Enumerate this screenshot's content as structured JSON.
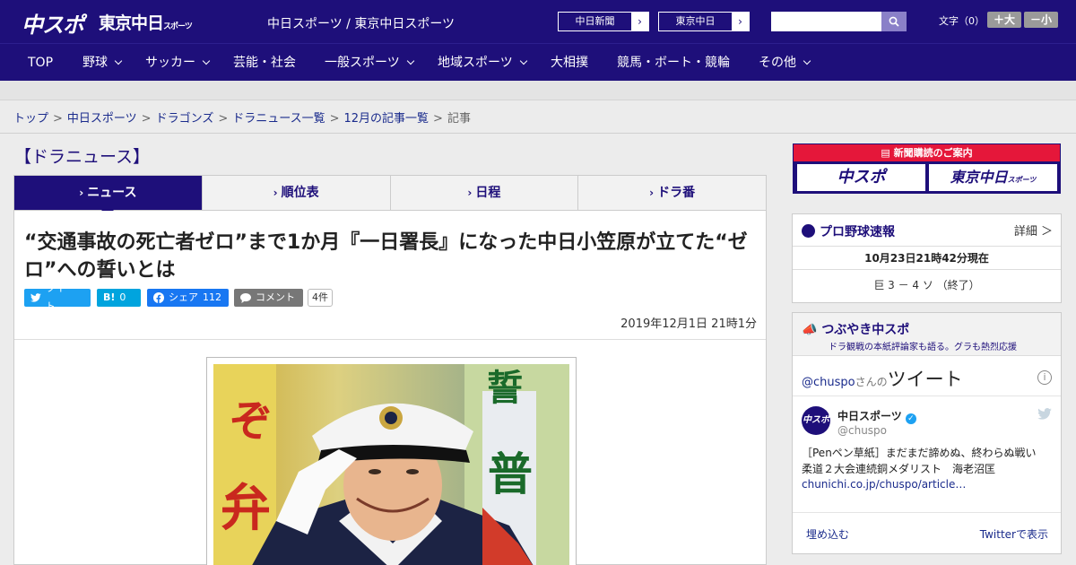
{
  "header": {
    "logo_main": "中スポ",
    "logo_tokyo": "東京中日",
    "logo_tokyo_sub": "スポーツ",
    "site_title": "中日スポーツ / 東京中日スポーツ",
    "paper_links": [
      "中日新聞",
      "東京中日"
    ],
    "search_placeholder": "",
    "font_size_label": "文字（0）",
    "font_larger": "＋大",
    "font_smaller": "－小"
  },
  "nav": {
    "items": [
      {
        "label": "TOP",
        "dropdown": false
      },
      {
        "label": "野球",
        "dropdown": true
      },
      {
        "label": "サッカー",
        "dropdown": true
      },
      {
        "label": "芸能・社会",
        "dropdown": false
      },
      {
        "label": "一般スポーツ",
        "dropdown": true
      },
      {
        "label": "地域スポーツ",
        "dropdown": true
      },
      {
        "label": "大相撲",
        "dropdown": false
      },
      {
        "label": "競馬・ボート・競輪",
        "dropdown": false
      },
      {
        "label": "その他",
        "dropdown": true
      }
    ]
  },
  "breadcrumb": [
    "トップ",
    "中日スポーツ",
    "ドラゴンズ",
    "ドラニュース一覧",
    "12月の記事一覧",
    "記事"
  ],
  "section_title": "【ドラニュース】",
  "tabs": [
    {
      "label": "ニュース",
      "active": true
    },
    {
      "label": "順位表",
      "active": false
    },
    {
      "label": "日程",
      "active": false
    },
    {
      "label": "ドラ番",
      "active": false
    }
  ],
  "article": {
    "headline": "“交通事故の死亡者ゼロ”まで1か月『一日署長』になった中日小笠原が立てた“ゼロ”への誓いとは",
    "share": {
      "tweet": "ツイート",
      "hatena_icon": "B!",
      "hatena_count": "0",
      "facebook": "シェア",
      "facebook_count": "112",
      "comment": "コメント",
      "comment_count": "4件"
    },
    "date": "2019年12月1日 21時1分"
  },
  "sidebar": {
    "promo": {
      "head": "新聞購読のご案内",
      "left": "中スポ",
      "right": "東京中日",
      "right_sub": "スポーツ"
    },
    "baseball": {
      "title": "プロ野球速報",
      "detail": "詳細 ＞",
      "timestamp": "10月23日21時42分現在",
      "score": "巨 3 － 4 ソ （終了）"
    },
    "tweets": {
      "title": "つぶやき中スポ",
      "subtitle": "ドラ観戦の本紙評論家も語る。グラも熱烈応援",
      "handle_prefix": "@chuspo",
      "handle_suffix": "さんの",
      "tweets_word": "ツイート",
      "account_name": "中日スポーツ",
      "account_handle": "@chuspo",
      "avatar_text": "中スポ",
      "tweet_text": "［Penペン草紙］まだまだ諦めぬ、終わらぬ戦い　柔道２大会連続銅メダリスト　海老沼匡",
      "tweet_link": "chunichi.co.jp/chuspo/article…",
      "embed": "埋め込む",
      "view_on": "Twitterで表示"
    }
  },
  "colors": {
    "brand_navy": "#1e0f7a",
    "promo_red": "#e5173a",
    "twitter_blue": "#1da1f2",
    "facebook_blue": "#1877f2"
  }
}
